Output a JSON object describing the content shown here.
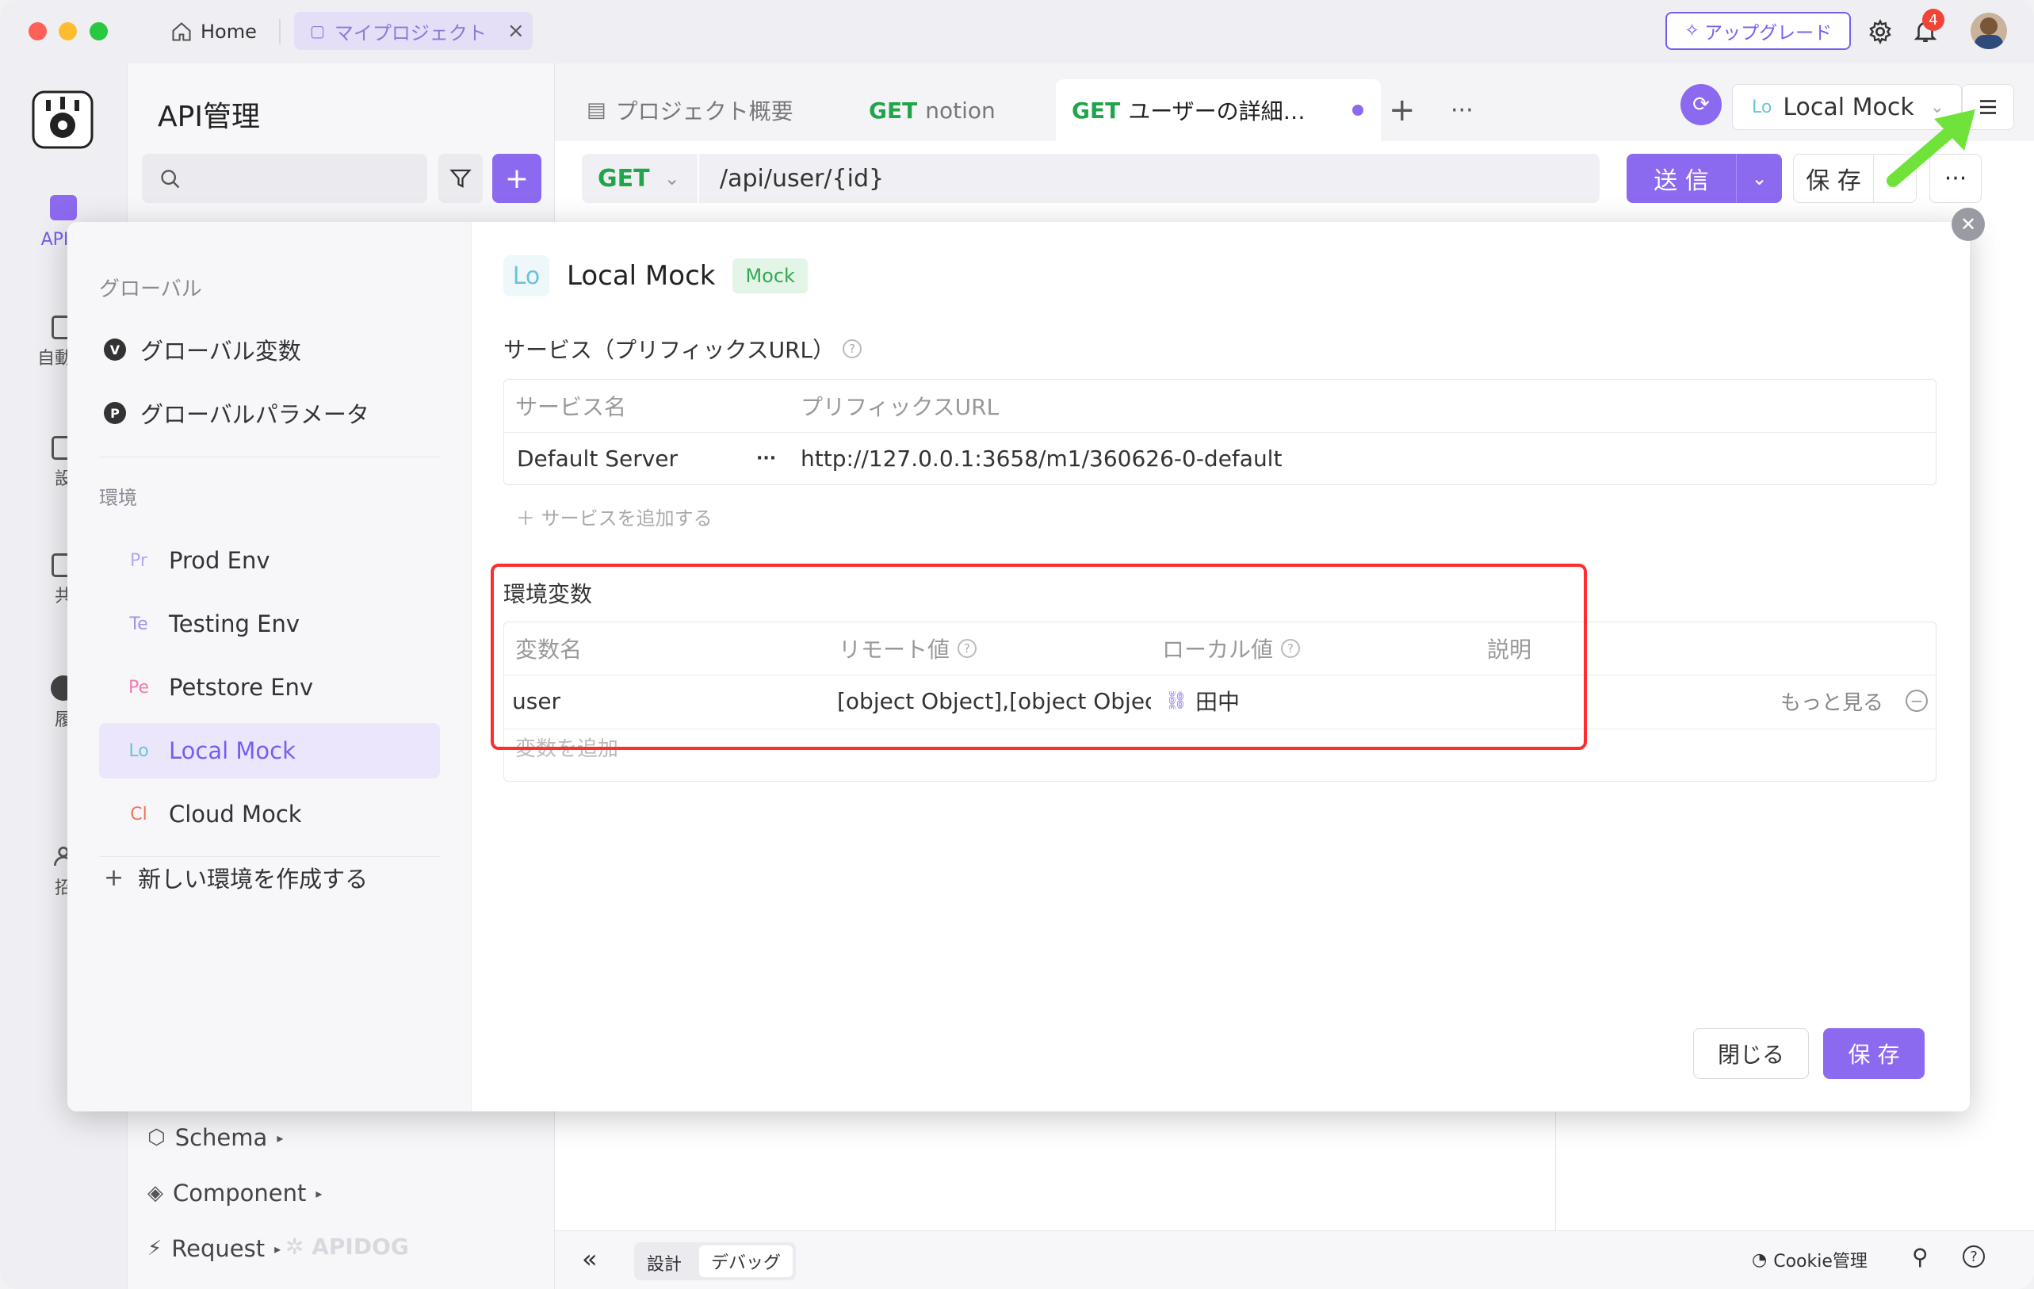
{
  "titlebar": {
    "home_label": "Home",
    "project_tab": "マイプロジェクト",
    "upgrade_label": "アップグレード",
    "notification_count": "4"
  },
  "rail": {
    "items": [
      {
        "label": "API管"
      },
      {
        "label": "自動テ"
      },
      {
        "label": "設"
      },
      {
        "label": "共"
      },
      {
        "label": "履"
      },
      {
        "label": "招"
      }
    ]
  },
  "sidebar": {
    "title": "API管理",
    "tree_bottom": [
      {
        "label": "Schema"
      },
      {
        "label": "Component"
      },
      {
        "label": "Request"
      }
    ],
    "watermark": "APIDOG"
  },
  "tabs": {
    "items": [
      {
        "label": "プロジェクト概要"
      },
      {
        "method": "GET",
        "label": "notion"
      },
      {
        "method": "GET",
        "label": "ユーザーの詳細…"
      }
    ],
    "env_selector": {
      "abbr": "Lo",
      "label": "Local Mock"
    }
  },
  "urlbar": {
    "method": "GET",
    "url": "/api/user/{id}",
    "send_label": "送 信",
    "save_label": "保 存"
  },
  "bottombar": {
    "design_label": "設計",
    "debug_label": "デバッグ",
    "cookie_label": "Cookie管理"
  },
  "dialog": {
    "left": {
      "global_section": "グローバル",
      "global_vars": "グローバル変数",
      "global_params": "グローバルパラメータ",
      "env_section": "環境",
      "envs": [
        {
          "abbr": "Pr",
          "label": "Prod Env",
          "color": "#b7a6ef"
        },
        {
          "abbr": "Te",
          "label": "Testing Env",
          "color": "#a490ea"
        },
        {
          "abbr": "Pe",
          "label": "Petstore Env",
          "color": "#ee7db0"
        },
        {
          "abbr": "Lo",
          "label": "Local Mock",
          "color": "#6bc3d8"
        },
        {
          "abbr": "Cl",
          "label": "Cloud Mock",
          "color": "#f0735a"
        }
      ],
      "new_env": "新しい環境を作成する"
    },
    "right": {
      "env_abbr": "Lo",
      "env_name": "Local Mock",
      "env_tag": "Mock",
      "service_title": "サービス（プリフィックスURL）",
      "service_headers": {
        "name": "サービス名",
        "url": "プリフィックスURL"
      },
      "service_row": {
        "name": "Default Server",
        "dots": "···",
        "url": "http://127.0.0.1:3658/m1/360626-0-default"
      },
      "add_service": "＋ サービスを追加する",
      "vars_title": "環境変数",
      "vars_headers": {
        "name": "変数名",
        "remote": "リモート値",
        "local": "ローカル値",
        "desc": "説明"
      },
      "vars_row": {
        "name": "user",
        "remote": "[object Object],[object Objec",
        "local": "田中",
        "more": "もっと見る"
      },
      "add_var": "変数を追加",
      "close_label": "閉じる",
      "save_label": "保 存"
    }
  },
  "colors": {
    "accent": "#8c6af0",
    "get_green": "#21a54a",
    "highlight_red": "#ff2d2d",
    "arrow_green": "#6fe33a"
  }
}
